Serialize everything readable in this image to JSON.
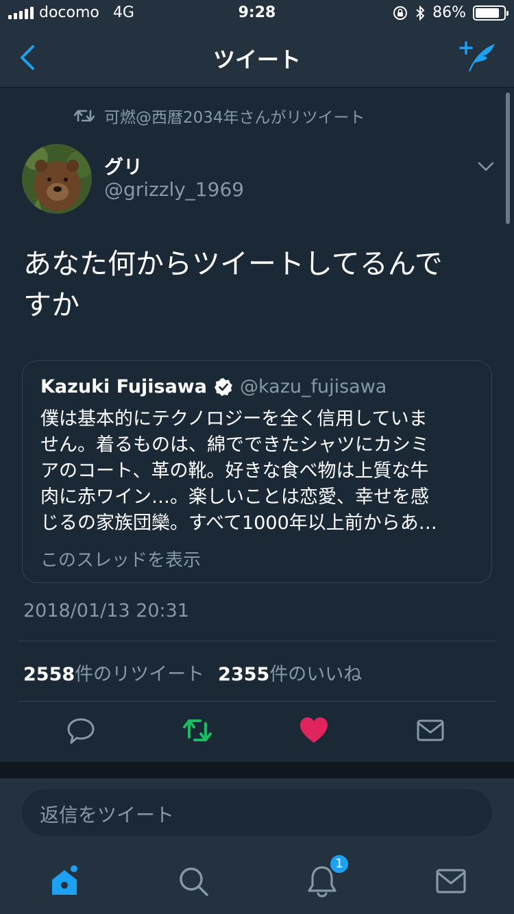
{
  "status_bar": {
    "carrier": "docomo",
    "network": "4G",
    "time": "9:28",
    "battery_text": "86%",
    "battery_level": 0.86,
    "icons": [
      "signal-icon",
      "lock-rotation-icon",
      "bluetooth-icon",
      "battery-icon"
    ]
  },
  "nav": {
    "title": "ツイート",
    "back_icon": "chevron-left-icon",
    "compose_icon": "compose-tweet-icon"
  },
  "retweet_context": {
    "text": "可燃@西暦2034年さんがリツイート",
    "icon": "retweet-icon"
  },
  "tweet": {
    "author_name": "グリ",
    "author_handle": "@grizzly_1969",
    "text_line1": "あなた何からツイートしてるんで",
    "text_line2": "すか",
    "timestamp": "2018/01/13 20:31",
    "retweet_count": "2558",
    "retweet_label": "件のリツイート",
    "like_count": "2355",
    "like_label": "件のいいね",
    "liked": true
  },
  "quote": {
    "name": "Kazuki Fujisawa",
    "verified": true,
    "handle": "@kazu_fujisawa",
    "lines": [
      "僕は基本的にテクノロジーを全く信用していま",
      "せん。着るものは、綿でできたシャツにカシミ",
      "アのコート、革の靴。好きな食べ物は上質な牛",
      "肉に赤ワイン…。楽しいことは恋愛、幸せを感",
      "じるの家族団欒。すべて1000年以上前からあ…"
    ],
    "show_thread": "このスレッドを表示"
  },
  "reply": {
    "placeholder": "返信をツイート"
  },
  "tabbar": {
    "items": [
      "home-icon",
      "search-icon",
      "notifications-icon",
      "messages-icon"
    ],
    "notification_badge": "1"
  },
  "colors": {
    "background": "#1b2836",
    "bar": "#24313f",
    "accent": "#1da1f2",
    "retweet_green": "#17bf63",
    "like_red": "#e0245e",
    "secondary_text": "#8899a6"
  }
}
